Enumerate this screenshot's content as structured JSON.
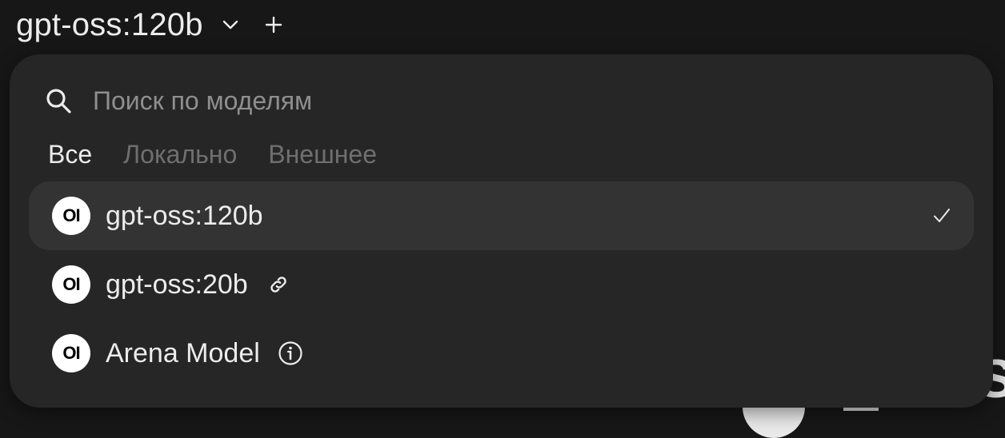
{
  "header": {
    "model_title": "gpt-oss:120b",
    "chevron_icon": "chevron-down-icon",
    "add_icon": "plus-icon"
  },
  "dropdown": {
    "search": {
      "placeholder": "Поиск по моделям",
      "value": "",
      "icon": "search-icon"
    },
    "tabs": [
      {
        "label": "Все",
        "active": true
      },
      {
        "label": "Локально",
        "active": false
      },
      {
        "label": "Внешнее",
        "active": false
      }
    ],
    "models": [
      {
        "logo_text": "OI",
        "label": "gpt-oss:120b",
        "selected": true,
        "trailing_icon": "check-icon"
      },
      {
        "logo_text": "OI",
        "label": "gpt-oss:20b",
        "selected": false,
        "inline_icon": "link-icon"
      },
      {
        "logo_text": "OI",
        "label": "Arena Model",
        "selected": false,
        "inline_icon": "info-icon"
      }
    ]
  },
  "colors": {
    "page_background": "#171717",
    "dropdown_background": "#262626",
    "selected_row_background": "#333333",
    "text_primary": "#ececec",
    "text_muted": "#6f6f6f"
  }
}
